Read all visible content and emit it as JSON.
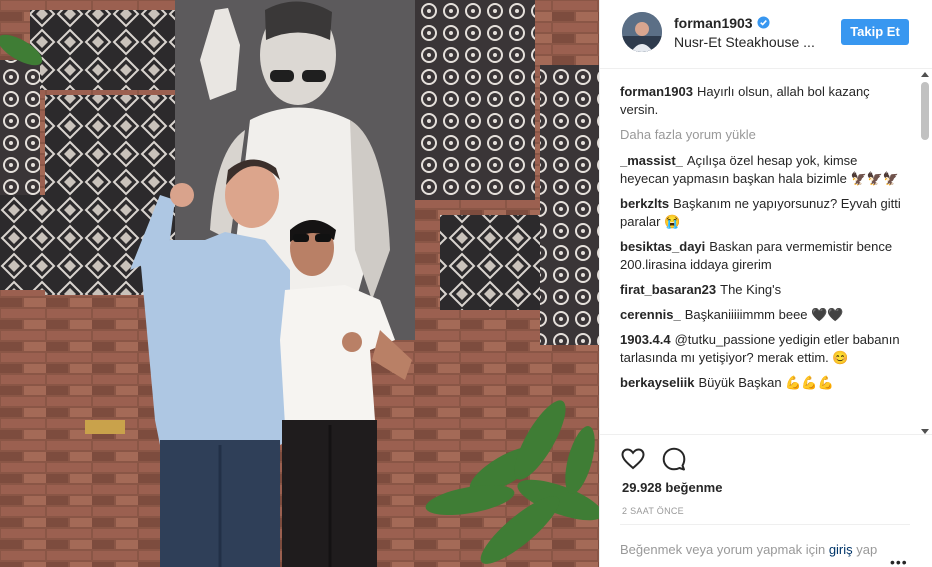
{
  "header": {
    "username": "forman1903",
    "location": "Nusr-Et Steakhouse ...",
    "follow_label": "Takip Et"
  },
  "caption": {
    "user": "forman1903",
    "text": "Hayırlı olsun, allah bol kazanç versin."
  },
  "load_more": "Daha fazla yorum yükle",
  "comments": [
    {
      "user": "_massist_",
      "text": "Açılışa özel hesap yok, kimse heyecan yapmasın başkan hala bizimle 🦅🦅🦅"
    },
    {
      "user": "berkzlts",
      "text": "Başkanım ne yapıyorsunuz? Eyvah gitti paralar 😭"
    },
    {
      "user": "besiktas_dayi",
      "text": "Baskan para vermemistir bence 200.lirasina iddaya girerim"
    },
    {
      "user": "firat_basaran23",
      "text": "The King's"
    },
    {
      "user": "cerennis_",
      "text": "Başkaniiiiimmm beee 🖤🖤"
    },
    {
      "user": "1903.4.4",
      "text": "@tutku_passione yedigin etler babanın tarlasında mı yetişiyor? merak ettim. 😊"
    },
    {
      "user": "berkayseliik",
      "text": "Büyük Başkan 💪💪💪"
    }
  ],
  "likes": "29.928 beğenme",
  "time": "2 SAAT ÖNCE",
  "add_comment": {
    "prefix": "Beğenmek veya yorum yapmak için ",
    "link": "giriş",
    "suffix": " yap"
  },
  "colors": {
    "accent": "#3897f0",
    "link": "#003569",
    "muted": "#999999",
    "emoji_eagle": "#8b6a3e",
    "emoji_arm": "#f6b93b"
  },
  "icons": [
    "verified-badge-icon",
    "heart-icon",
    "comment-bubble-icon",
    "more-options-icon"
  ]
}
